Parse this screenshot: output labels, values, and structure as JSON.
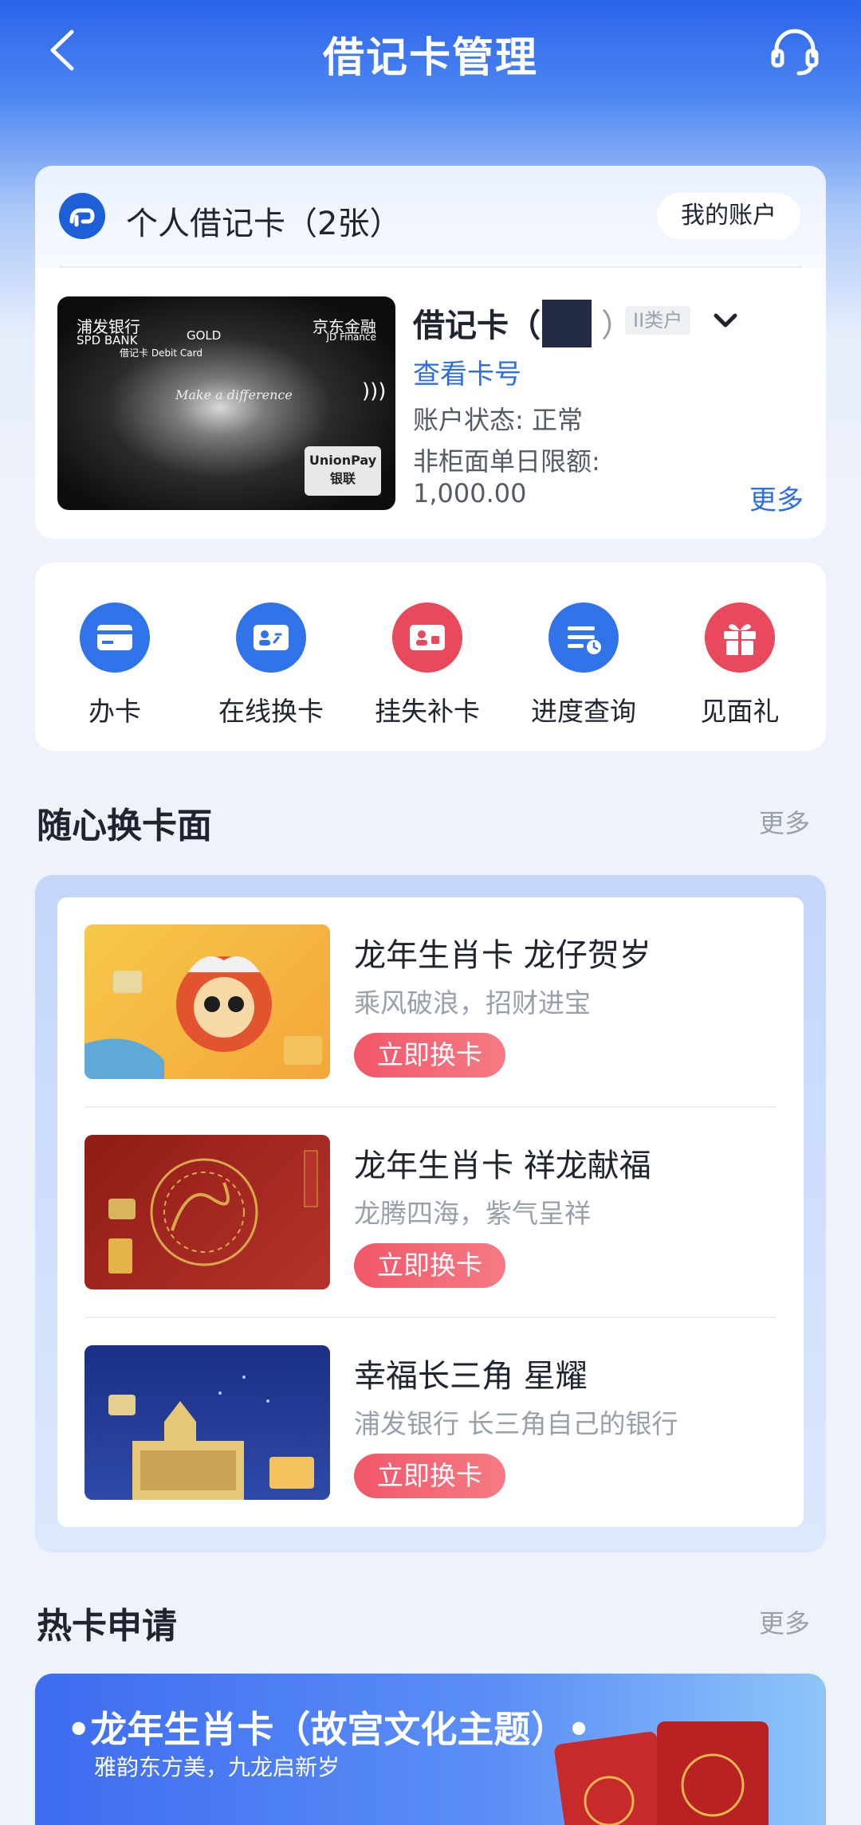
{
  "header": {
    "title": "借记卡管理"
  },
  "account": {
    "title": "个人借记卡（2张）",
    "my_account_label": "我的账户",
    "card_name": "借记卡（",
    "card_close_paren": "）",
    "class_badge": "II类户",
    "view_card_no": "查看卡号",
    "status": "账户状态: 正常",
    "limit_label": "非柜面单日限额:",
    "limit_value": "1,000.00",
    "more_label": "更多",
    "card_image": {
      "bank_cn": "浦发银行",
      "bank_en": "SPD BANK",
      "tier": "GOLD",
      "debit": "借记卡 Debit Card",
      "partner_cn": "京东金融",
      "partner_en": "JD Finance",
      "slogan": "Make a difference",
      "network": "UnionPay 银联"
    }
  },
  "actions": [
    {
      "label": "办卡",
      "icon": "card-icon",
      "color": "#3173e8"
    },
    {
      "label": "在线换卡",
      "icon": "card-swap-icon",
      "color": "#3173e8"
    },
    {
      "label": "挂失补卡",
      "icon": "card-lock-icon",
      "color": "#e9495c"
    },
    {
      "label": "进度查询",
      "icon": "progress-list-icon",
      "color": "#3173e8"
    },
    {
      "label": "见面礼",
      "icon": "gift-icon",
      "color": "#e9495c"
    }
  ],
  "face_section": {
    "title": "随心换卡面",
    "more_label": "更多"
  },
  "faces": [
    {
      "title": "龙年生肖卡 龙仔贺岁",
      "subtitle": "乘风破浪，招财进宝",
      "button": "立即换卡"
    },
    {
      "title": "龙年生肖卡 祥龙献福",
      "subtitle": "龙腾四海，紫气呈祥",
      "button": "立即换卡"
    },
    {
      "title": "幸福长三角 星耀",
      "subtitle": "浦发银行 长三角自己的银行",
      "button": "立即换卡"
    }
  ],
  "hot_section": {
    "title": "热卡申请",
    "more_label": "更多"
  },
  "banner": {
    "title": "•龙年生肖卡（故宫文化主题）•",
    "subtitle": "雅韵东方美，九龙启新岁"
  }
}
